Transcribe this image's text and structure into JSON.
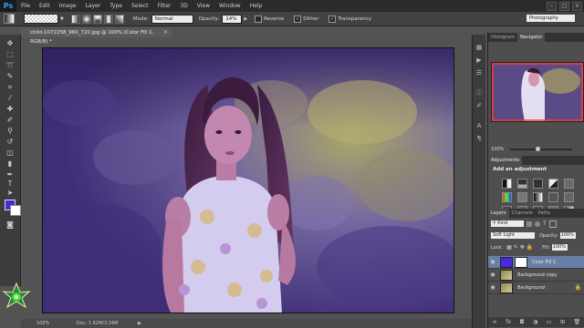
{
  "app": {
    "logo": "Ps",
    "menu": [
      "File",
      "Edit",
      "Image",
      "Layer",
      "Type",
      "Select",
      "Filter",
      "3D",
      "View",
      "Window",
      "Help"
    ]
  },
  "options_bar": {
    "mode_label": "Mode:",
    "mode_value": "Normal",
    "opacity_label": "Opacity:",
    "opacity_value": "14%",
    "reverse_label": "Reverse",
    "dither_label": "Dither",
    "transparency_label": "Transparency",
    "workspace": "Photography"
  },
  "document": {
    "tab_title": "child-1072258_960_720.jpg @ 100% (Color Fill 1, RGB/8) *",
    "tab_close": "×"
  },
  "status": {
    "zoom": "100%",
    "doc": "Doc: 1.62M/3.24M"
  },
  "panels": {
    "top_tabs": [
      "Histogram",
      "Navigator"
    ],
    "navigator_zoom": "100%",
    "adjust_tabs": [
      "Adjustments"
    ],
    "adjust_title": "Add an adjustment",
    "layer_tabs": [
      "Layers",
      "Channels",
      "Paths"
    ],
    "kind_label": "Kind",
    "blend_mode": "Soft Light",
    "opacity_label": "Opacity:",
    "opacity_value": "100%",
    "lock_label": "Lock:",
    "fill_label": "Fill:",
    "fill_value": "100%",
    "layers": [
      {
        "name": "Color Fill 1"
      },
      {
        "name": "Background copy"
      },
      {
        "name": "Background"
      }
    ]
  },
  "colors": {
    "foreground": "#4b28d9",
    "background": "#ffffff",
    "accent": "#ff3b3b"
  }
}
